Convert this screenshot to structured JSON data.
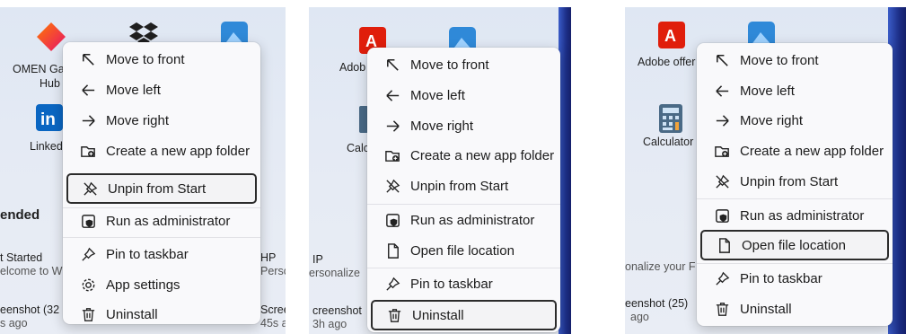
{
  "panels": [
    {
      "background": {
        "app1": "OMEN Ga",
        "app1_line2": "Hub",
        "app2": "Linked",
        "section": "ended",
        "rec1_title": "t Started",
        "rec1_sub": "elcome to W",
        "rec2_title": "HP",
        "rec2_sub": "Persc",
        "rec3_title": "eenshot (32",
        "rec3_sub": "s ago",
        "rec4_title": "Scree",
        "rec4_sub": "45s a"
      },
      "menu": {
        "items": [
          {
            "label": "Move to front",
            "icon": "arrow-up-left-icon"
          },
          {
            "label": "Move left",
            "icon": "arrow-left-icon"
          },
          {
            "label": "Move right",
            "icon": "arrow-right-icon"
          },
          {
            "label": "Create a new app folder",
            "icon": "new-folder-icon"
          },
          {
            "label": "Unpin from Start",
            "icon": "unpin-icon",
            "selected": true
          },
          {
            "label": "Run as administrator",
            "icon": "shield-icon"
          },
          {
            "label": "Pin to taskbar",
            "icon": "pin-icon"
          },
          {
            "label": "App settings",
            "icon": "gear-icon"
          },
          {
            "label": "Uninstall",
            "icon": "trash-icon"
          }
        ]
      }
    },
    {
      "background": {
        "app1": "Adob",
        "app2": "Calc",
        "rec1_title": "IP",
        "rec1_sub": "ersonalize",
        "rec2_title": "creenshot",
        "rec2_sub": "3h ago"
      },
      "menu": {
        "items": [
          {
            "label": "Move to front",
            "icon": "arrow-up-left-icon"
          },
          {
            "label": "Move left",
            "icon": "arrow-left-icon"
          },
          {
            "label": "Move right",
            "icon": "arrow-right-icon"
          },
          {
            "label": "Create a new app folder",
            "icon": "new-folder-icon"
          },
          {
            "label": "Unpin from Start",
            "icon": "unpin-icon"
          },
          {
            "label": "Run as administrator",
            "icon": "shield-icon"
          },
          {
            "label": "Open file location",
            "icon": "file-icon"
          },
          {
            "label": "Pin to taskbar",
            "icon": "pin-icon"
          },
          {
            "label": "Uninstall",
            "icon": "trash-icon",
            "selected": true
          }
        ]
      }
    },
    {
      "background": {
        "app1": "Adobe offer",
        "app2": "Calculator",
        "rec1_sub": "onalize your F",
        "rec2_title": "eenshot (25)",
        "rec2_sub": "ago"
      },
      "menu": {
        "items": [
          {
            "label": "Move to front",
            "icon": "arrow-up-left-icon"
          },
          {
            "label": "Move left",
            "icon": "arrow-left-icon"
          },
          {
            "label": "Move right",
            "icon": "arrow-right-icon"
          },
          {
            "label": "Create a new app folder",
            "icon": "new-folder-icon"
          },
          {
            "label": "Unpin from Start",
            "icon": "unpin-icon"
          },
          {
            "label": "Run as administrator",
            "icon": "shield-icon"
          },
          {
            "label": "Open file location",
            "icon": "file-icon",
            "selected": true
          },
          {
            "label": "Pin to taskbar",
            "icon": "pin-icon"
          },
          {
            "label": "Uninstall",
            "icon": "trash-icon"
          }
        ]
      }
    }
  ],
  "colors": {
    "selection_border": "#2b2b2b",
    "menu_background": "#f9f9fb",
    "omen_red": "#e8331b",
    "adobe_red": "#e01e0b",
    "linkedin_blue": "#0a66c2"
  }
}
